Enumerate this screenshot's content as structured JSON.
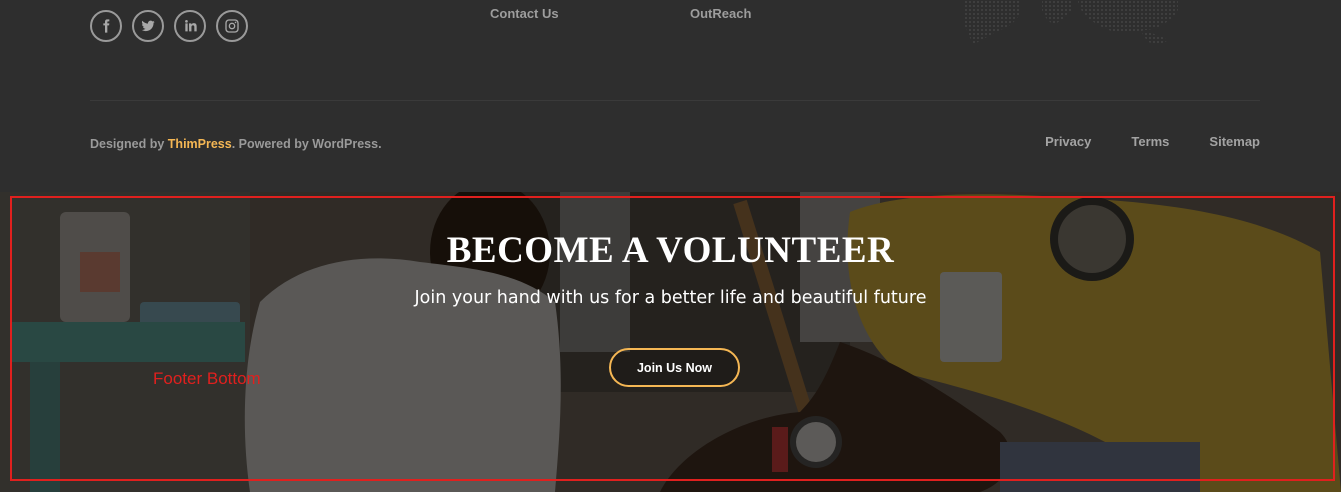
{
  "footer": {
    "social": [
      {
        "icon": "facebook-icon"
      },
      {
        "icon": "twitter-icon"
      },
      {
        "icon": "linkedin-icon"
      },
      {
        "icon": "instagram-icon"
      }
    ],
    "links": {
      "contact": "Contact Us",
      "outreach": "OutReach"
    },
    "credits": {
      "prefix": "Designed by ",
      "brand": "ThimPress",
      "suffix": ". Powered by WordPress."
    },
    "menu": {
      "privacy": "Privacy",
      "terms": "Terms",
      "sitemap": "Sitemap"
    }
  },
  "banner": {
    "title": "BECOME A VOLUNTEER",
    "subtitle": "Join your hand with us for a better life and beautiful future",
    "button": "Join Us Now",
    "annotation": "Footer Bottom"
  },
  "colors": {
    "accent": "#f5b754",
    "annotation": "#e0201e",
    "footer_bg": "#2e2e2e"
  }
}
